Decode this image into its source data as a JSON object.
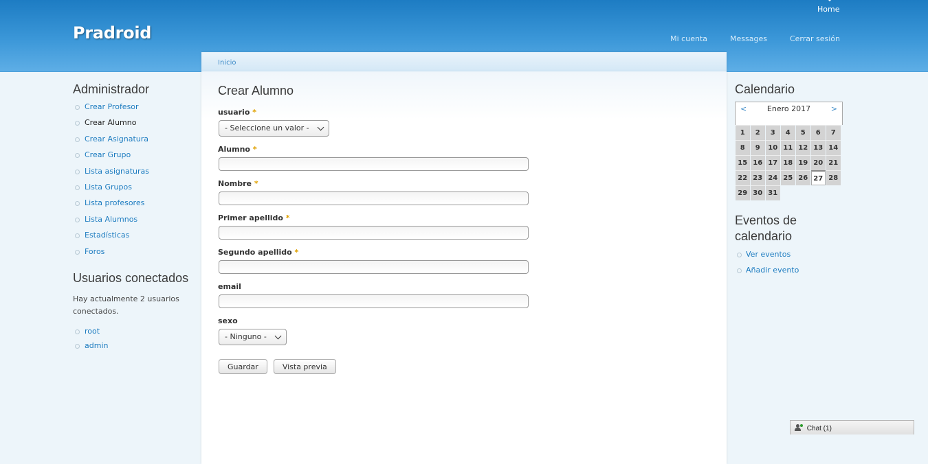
{
  "header": {
    "site_name": "Pradroid",
    "primary": {
      "home": "Home"
    },
    "secondary": [
      "Mi cuenta",
      "Messages",
      "Cerrar sesión"
    ]
  },
  "breadcrumb": {
    "home": "Inicio"
  },
  "sidebar_left": {
    "admin_title": "Administrador",
    "menu": [
      {
        "label": "Crear Profesor",
        "active": false
      },
      {
        "label": "Crear Alumno",
        "active": true
      },
      {
        "label": "Crear Asignatura",
        "active": false
      },
      {
        "label": "Crear Grupo",
        "active": false
      },
      {
        "label": "Lista asignaturas",
        "active": false
      },
      {
        "label": "Lista Grupos",
        "active": false
      },
      {
        "label": "Lista profesores",
        "active": false
      },
      {
        "label": "Lista Alumnos",
        "active": false
      },
      {
        "label": "Estadísticas",
        "active": false
      },
      {
        "label": "Foros",
        "active": false
      }
    ],
    "online_title": "Usuarios conectados",
    "online_text": "Hay actualmente 2 usuarios conectados.",
    "online_users": [
      "root",
      "admin"
    ]
  },
  "form": {
    "title": "Crear Alumno",
    "required_marker": "*",
    "usuario_label": "usuario",
    "usuario_value": "- Seleccione un valor -",
    "alumno_label": "Alumno",
    "alumno_value": "",
    "nombre_label": "Nombre",
    "nombre_value": "",
    "primer_apellido_label": "Primer apellido",
    "primer_apellido_value": "",
    "segundo_apellido_label": "Segundo apellido",
    "segundo_apellido_value": "",
    "email_label": "email",
    "email_value": "",
    "sexo_label": "sexo",
    "sexo_value": "- Ninguno -",
    "save_label": "Guardar",
    "preview_label": "Vista previa"
  },
  "sidebar_right": {
    "calendar_title": "Calendario",
    "calendar": {
      "prev": "<",
      "next": ">",
      "month": "Enero 2017",
      "days": [
        "1",
        "2",
        "3",
        "4",
        "5",
        "6",
        "7",
        "8",
        "9",
        "10",
        "11",
        "12",
        "13",
        "14",
        "15",
        "16",
        "17",
        "18",
        "19",
        "20",
        "21",
        "22",
        "23",
        "24",
        "25",
        "26",
        "27",
        "28",
        "29",
        "30",
        "31"
      ],
      "today": "27"
    },
    "events_title": "Eventos de calendario",
    "events_links": [
      "Ver eventos",
      "Añadir evento"
    ]
  },
  "chat": {
    "label": "Chat (1)"
  }
}
